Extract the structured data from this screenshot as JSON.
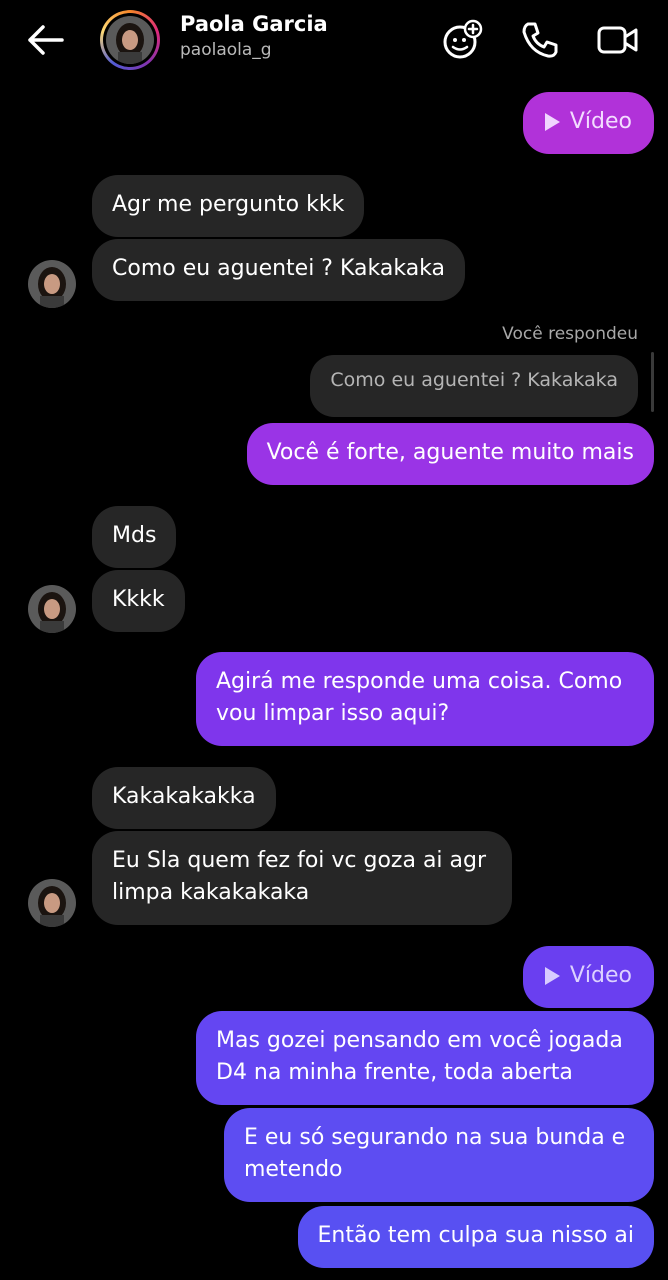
{
  "header": {
    "name": "Paola Garcia",
    "username": "paolaola_g",
    "icons": [
      "back-arrow-icon",
      "effects-icon",
      "phone-icon",
      "video-call-icon"
    ]
  },
  "messages": {
    "m1": "Vídeo",
    "m2": "Agr me pergunto kkk",
    "m3": "Como eu aguentei ? Kakakaka",
    "reply_label": "Você respondeu",
    "reply_quote": "Como eu aguentei ? Kakakaka",
    "m4": "Você é forte, aguente muito mais",
    "m5": "Mds",
    "m6": "Kkkk",
    "m7_line1": "Agirá me responde uma coisa. Como",
    "m7_line2": "vou limpar isso aqui?",
    "m8": "Kakakakakka",
    "m9_line1": "Eu Sla quem fez foi vc goza ai agr",
    "m9_line2": "limpa kakakakaka",
    "m10": "Vídeo",
    "m11_line1": "Mas gozei pensando em você jogada",
    "m11_line2": "D4 na minha frente, toda aberta",
    "m12_line1": "E eu só segurando na sua bunda e",
    "m12_line2": "metendo",
    "m13": "Então tem culpa sua nisso ai"
  },
  "colors": {
    "incoming_bubble": "#262626",
    "outgoing_top": "#a52fd6",
    "outgoing_mid": "#7c3aed",
    "outgoing_bottom": "#5b4cf0",
    "background": "#000000"
  }
}
